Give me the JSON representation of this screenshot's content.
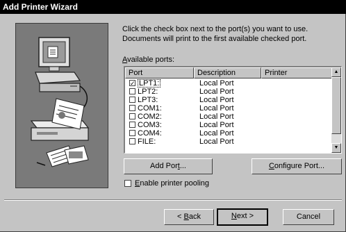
{
  "window": {
    "title": "Add Printer Wizard"
  },
  "instructions": {
    "line1": "Click the check box next to the port(s) you want to use.",
    "line2": "Documents will print to the first available checked port."
  },
  "available_ports": {
    "mnemonic": "A",
    "rest": "vailable ports:"
  },
  "table": {
    "headers": {
      "port": "Port",
      "description": "Description",
      "printer": "Printer"
    },
    "rows": [
      {
        "port": "LPT1:",
        "description": "Local Port",
        "checked": true
      },
      {
        "port": "LPT2:",
        "description": "Local Port",
        "checked": false
      },
      {
        "port": "LPT3:",
        "description": "Local Port",
        "checked": false
      },
      {
        "port": "COM1:",
        "description": "Local Port",
        "checked": false
      },
      {
        "port": "COM2:",
        "description": "Local Port",
        "checked": false
      },
      {
        "port": "COM3:",
        "description": "Local Port",
        "checked": false
      },
      {
        "port": "COM4:",
        "description": "Local Port",
        "checked": false
      },
      {
        "port": "FILE:",
        "description": "Local Port",
        "checked": false
      }
    ],
    "check_glyph": "✓"
  },
  "buttons": {
    "add_port": {
      "pre": "Add Por",
      "mnemonic": "t",
      "post": "..."
    },
    "configure_port": {
      "pre": "",
      "mnemonic": "C",
      "post": "onfigure Port..."
    },
    "back": {
      "arrow": "<",
      "mnemonic": "B",
      "post": "ack"
    },
    "next": {
      "mnemonic": "N",
      "post": "ext",
      "arrow": ">"
    },
    "cancel": "Cancel"
  },
  "pooling": {
    "mnemonic": "E",
    "rest": "nable printer pooling",
    "checked": false
  },
  "icons": {
    "up": "▲",
    "down": "▼"
  },
  "colors": {
    "title_bar": "#000000",
    "dialog_face": "#c4c4c4",
    "art_panel": "#7a7a7a"
  }
}
